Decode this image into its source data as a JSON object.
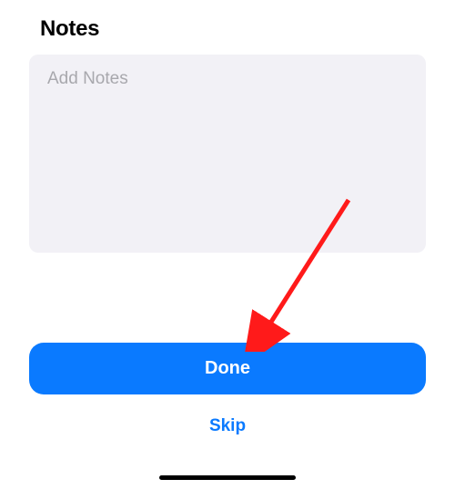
{
  "header": {
    "title": "Notes"
  },
  "notes": {
    "placeholder": "Add Notes",
    "value": ""
  },
  "buttons": {
    "done": "Done",
    "skip": "Skip"
  },
  "annotation": {
    "arrow_color": "#ff1a1a",
    "target": "done-button"
  }
}
